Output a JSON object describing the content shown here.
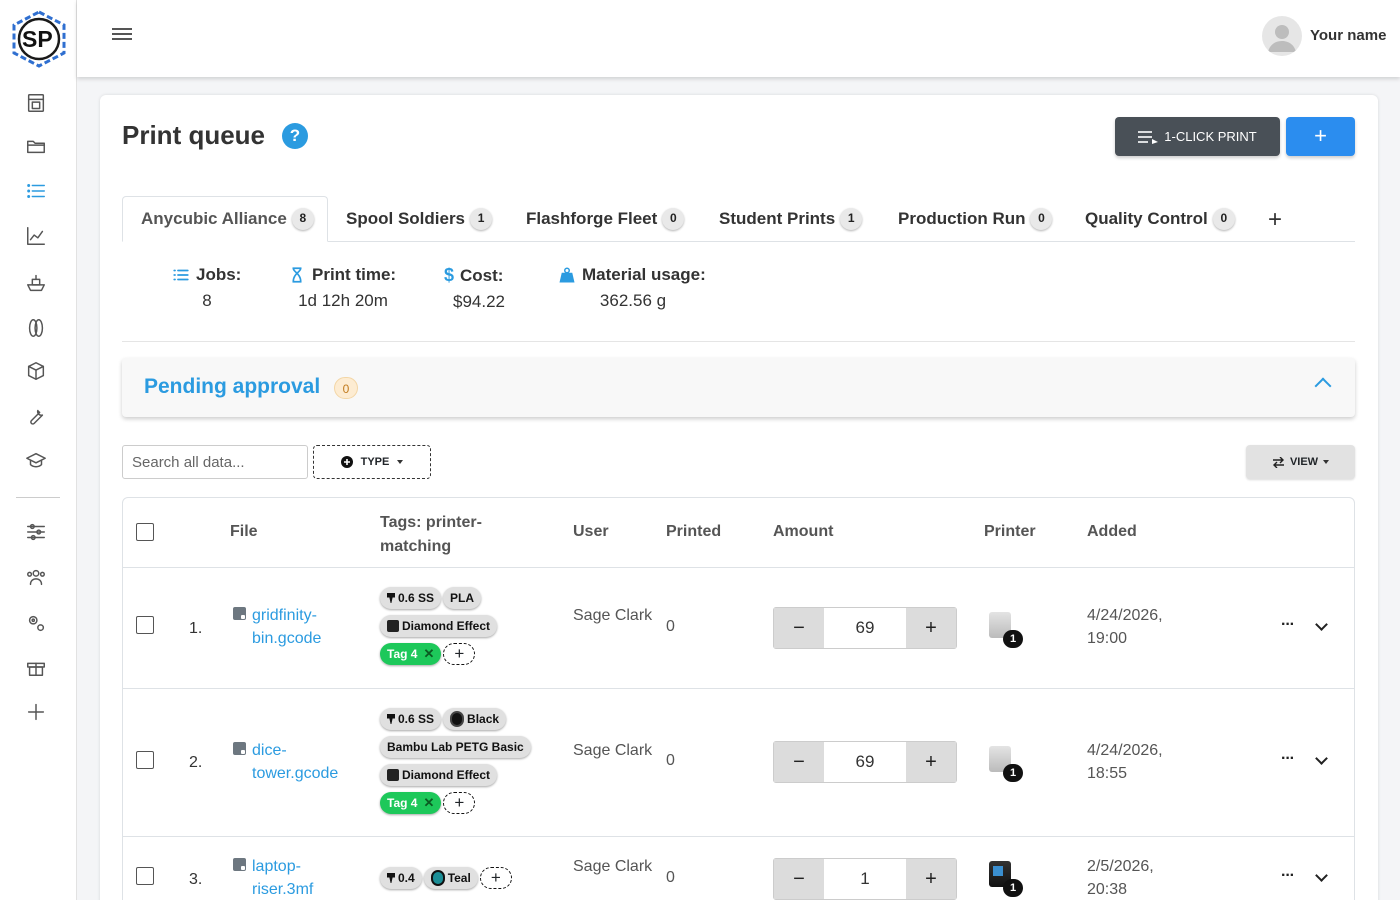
{
  "app": {
    "logo_text": "SP",
    "user_name": "Your name"
  },
  "sidebar": {
    "items": [
      {
        "name": "printers-icon"
      },
      {
        "name": "folder-icon"
      },
      {
        "name": "list-icon"
      },
      {
        "name": "chart-icon"
      },
      {
        "name": "ship-icon"
      },
      {
        "name": "spool-icon"
      },
      {
        "name": "cube-icon"
      },
      {
        "name": "wrench-icon"
      },
      {
        "name": "graduation-cap-icon"
      },
      {
        "name": "sliders-icon"
      },
      {
        "name": "users-icon"
      },
      {
        "name": "gears-icon"
      },
      {
        "name": "gift-icon"
      },
      {
        "name": "plus-icon"
      }
    ],
    "active_item": "list-icon"
  },
  "page": {
    "title": "Print queue",
    "help_label": "?",
    "one_click_label": "1-CLICK PRINT",
    "add_label": "+"
  },
  "tabs": [
    {
      "label": "Anycubic Alliance",
      "count": "8"
    },
    {
      "label": "Spool Soldiers",
      "count": "1"
    },
    {
      "label": "Flashforge Fleet",
      "count": "0"
    },
    {
      "label": "Student Prints",
      "count": "1"
    },
    {
      "label": "Production Run",
      "count": "0"
    },
    {
      "label": "Quality Control",
      "count": "0"
    }
  ],
  "tab_add_label": "+",
  "stats": {
    "jobs": {
      "label": "Jobs:",
      "value": "8"
    },
    "print_time": {
      "label": "Print time:",
      "value": "1d 12h 20m"
    },
    "cost": {
      "label": "Cost:",
      "value": "$94.22"
    },
    "material": {
      "label": "Material usage:",
      "value": "362.56 g"
    }
  },
  "pending": {
    "title": "Pending approval",
    "count": "0"
  },
  "filters": {
    "search_placeholder": "Search all data...",
    "type_label": "TYPE",
    "view_label": "VIEW"
  },
  "table": {
    "headers": {
      "file": "File",
      "tags": "Tags: printer-matching",
      "user": "User",
      "printed": "Printed",
      "amount": "Amount",
      "printer": "Printer",
      "added": "Added"
    },
    "rows": [
      {
        "num": "1.",
        "file": "gridfinity-bin.gcode",
        "tags": {
          "nozzle": "0.6 SS",
          "material": "PLA",
          "effect": "Diamond Effect",
          "custom": "Tag 4"
        },
        "user": "Sage Clark",
        "printed": "0",
        "amount": "69",
        "printer_count": "1",
        "added": "4/24/2026, 19:00"
      },
      {
        "num": "2.",
        "file": "dice-tower.gcode",
        "tags": {
          "nozzle": "0.6 SS",
          "color": "Black",
          "filament": "Bambu Lab PETG Basic",
          "effect": "Diamond Effect",
          "custom": "Tag 4"
        },
        "user": "Sage Clark",
        "printed": "0",
        "amount": "69",
        "printer_count": "1",
        "added": "4/24/2026, 18:55"
      },
      {
        "num": "3.",
        "file": "laptop-riser.3mf",
        "tags": {
          "nozzle": "0.4",
          "color": "Teal"
        },
        "user": "Sage Clark",
        "printed": "0",
        "amount": "1",
        "printer_count": "1",
        "added": "2/5/2026, 20:38"
      }
    ],
    "minus_label": "−",
    "plus_label": "+",
    "more_label": "···"
  },
  "colors": {
    "accent": "#2b9be0",
    "primary_button": "#2b8def",
    "dark_button": "#495057",
    "tag_green": "#1dc85a"
  }
}
